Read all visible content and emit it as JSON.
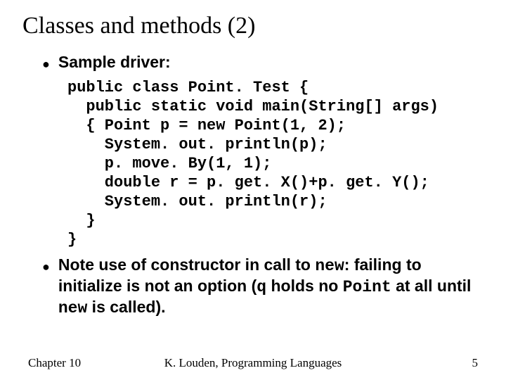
{
  "title": "Classes and methods (2)",
  "bullets": {
    "b1": "Sample driver:",
    "b2_pre": "Note use of constructor in call to ",
    "b2_new": "new",
    "b2_mid": ": failing to initialize is not an option (",
    "b2_q": "q",
    "b2_mid2": " holds no ",
    "b2_point": "Point",
    "b2_mid3": " at all until ",
    "b2_new2": "new",
    "b2_end": " is called)."
  },
  "code": "public class Point. Test {\n  public static void main(String[] args)\n  { Point p = new Point(1, 2);\n    System. out. println(p);\n    p. move. By(1, 1);\n    double r = p. get. X()+p. get. Y();\n    System. out. println(r);\n  }\n}",
  "footer": {
    "left": "Chapter 10",
    "center": "K. Louden, Programming Languages",
    "right": "5"
  }
}
